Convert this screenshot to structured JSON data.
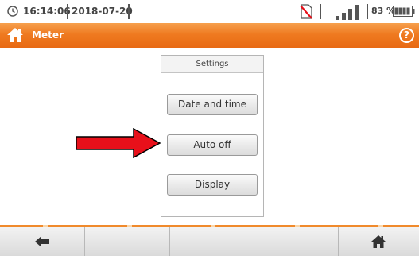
{
  "status_bar": {
    "time": "16:14:06",
    "date": "2018-07-20",
    "battery_percent": "83 %",
    "icons": [
      "clock-icon",
      "no-memory-card-icon",
      "signal-strength-icon",
      "battery-icon"
    ]
  },
  "title_bar": {
    "title": "Meter",
    "help_label": "?",
    "icons": [
      "home-icon",
      "help-icon"
    ]
  },
  "settings_panel": {
    "header": "Settings",
    "items": [
      {
        "label": "Date and time"
      },
      {
        "label": "Auto off"
      },
      {
        "label": "Display"
      }
    ]
  },
  "annotation": {
    "icon": "red-arrow-icon",
    "color": "#e8101a",
    "points_to": "Auto off"
  },
  "bottom_bar": {
    "icons": [
      "back-arrow-icon",
      "home-icon"
    ]
  },
  "colors": {
    "accent_orange": "#ef7a20",
    "annotation_red": "#e8101a"
  }
}
